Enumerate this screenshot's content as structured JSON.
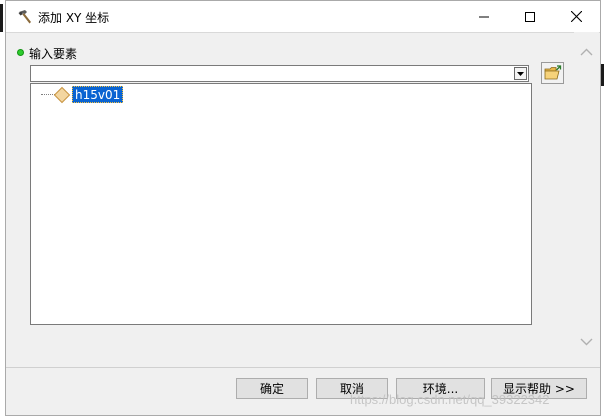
{
  "window": {
    "title": "添加 XY 坐标",
    "title_icon": "hammer-icon",
    "controls": [
      "minimize-icon",
      "maximize-icon",
      "close-icon"
    ]
  },
  "form": {
    "input_label": "输入要素",
    "combo_value": "",
    "browse_icon": "open-folder-icon"
  },
  "tree": {
    "items": [
      {
        "label": "h15v01",
        "icon": "feature-diamond-icon",
        "selected": true
      }
    ]
  },
  "buttons": {
    "ok": "确定",
    "cancel": "取消",
    "environment": "环境...",
    "show_help": "显示帮助 >>"
  },
  "watermark": "https://blog.csdn.net/qq_39322342",
  "colors": {
    "selection": "#0a64d2",
    "status_dot": "#2dcc2d"
  }
}
